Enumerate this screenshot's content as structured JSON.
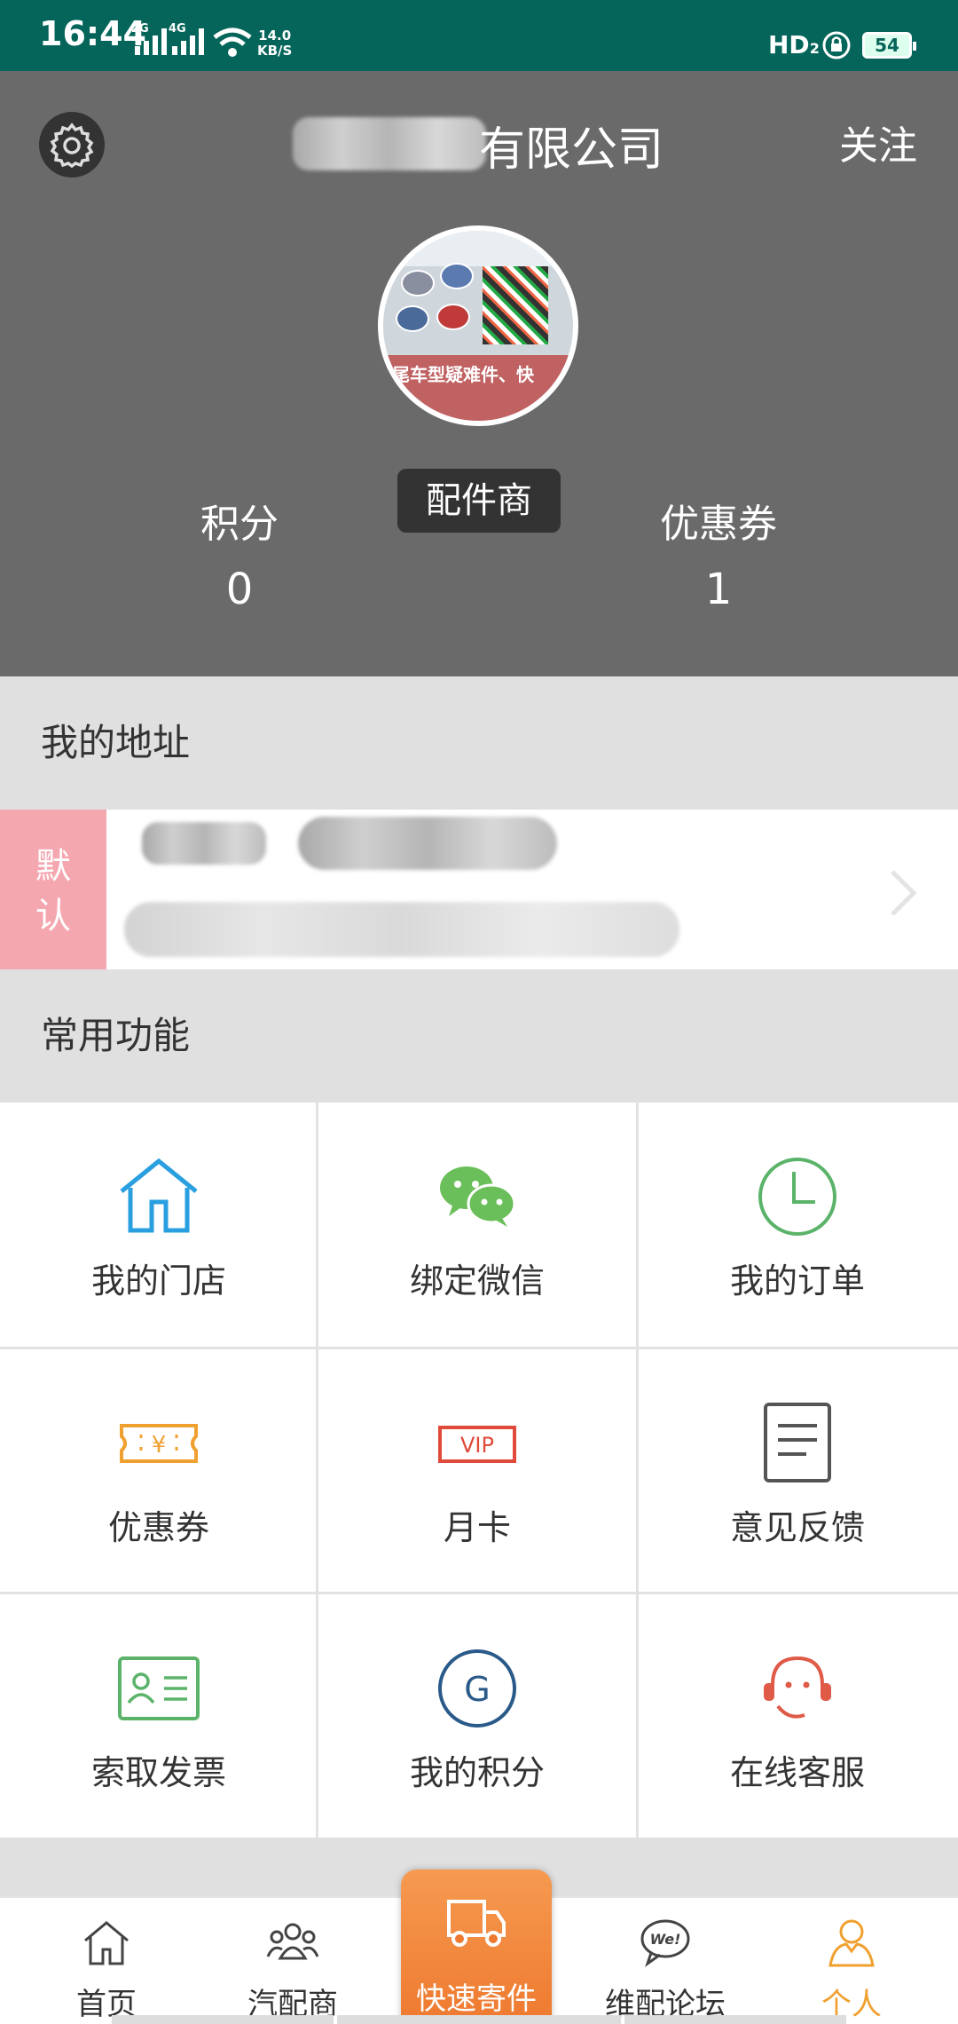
{
  "status_bar": {
    "time": "16:44",
    "signal_1": "2G",
    "signal_2": "4G",
    "net_speed_value": "14.0",
    "net_speed_unit": "KB/S",
    "hd": "HD",
    "hd_sub": "2",
    "battery": "54"
  },
  "header": {
    "company_suffix": "有限公司",
    "follow_label": "关注",
    "avatar_text": "尾车型疑难件、快",
    "badge": "配件商",
    "points_label": "积分",
    "points_value": "0",
    "coupons_label": "优惠券",
    "coupons_value": "1"
  },
  "address": {
    "section_title": "我的地址",
    "default_tag_1": "默",
    "default_tag_2": "认"
  },
  "functions": {
    "section_title": "常用功能",
    "items": [
      {
        "label": "我的门店",
        "icon": "store-icon"
      },
      {
        "label": "绑定微信",
        "icon": "wechat-icon"
      },
      {
        "label": "我的订单",
        "icon": "clock-icon"
      },
      {
        "label": "优惠券",
        "icon": "coupon-icon"
      },
      {
        "label": "月卡",
        "icon": "vip-icon"
      },
      {
        "label": "意见反馈",
        "icon": "feedback-icon"
      },
      {
        "label": "索取发票",
        "icon": "invoice-icon"
      },
      {
        "label": "我的积分",
        "icon": "points-icon"
      },
      {
        "label": "在线客服",
        "icon": "customer-service-icon"
      }
    ]
  },
  "bottom_nav": {
    "home": "首页",
    "dealers": "汽配商",
    "express": "快速寄件",
    "forum": "维配论坛",
    "profile": "个人"
  },
  "colors": {
    "status_bar": "#05655a",
    "header_bg": "#6a6a6a",
    "accent_orange": "#ee7a30",
    "default_tag": "#f5a7b0",
    "blue": "#2a9fe0",
    "green": "#6bbf5a"
  }
}
